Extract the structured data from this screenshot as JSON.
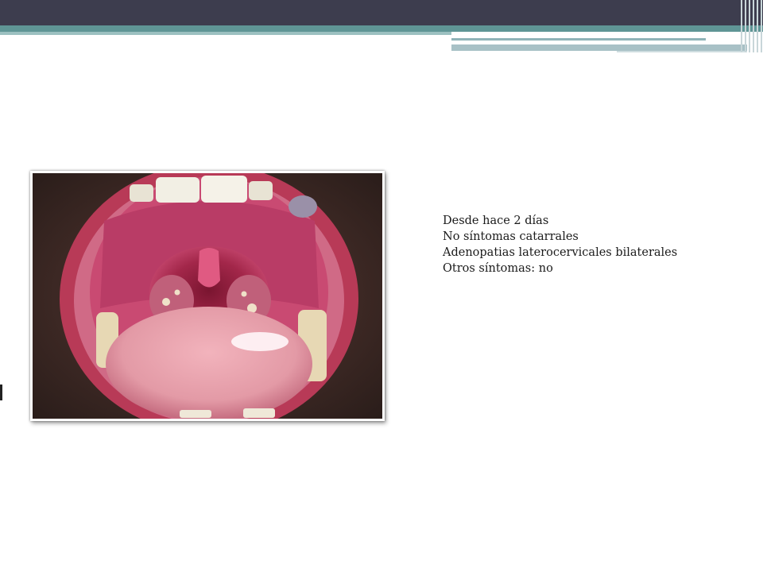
{
  "slide": {
    "notes": [
      " Desde hace 2 días",
      "No síntomas catarrales",
      "Adenopatias laterocervicales bilaterales",
      "Otros síntomas: no"
    ],
    "photo": {
      "icon": "open-mouth-throat-photo",
      "colors": {
        "skin": "#3a2a26",
        "lips": "#c23c5a",
        "palate": "#c94a72",
        "throat": "#8b1e3c",
        "tongue": "#e39aa6",
        "teeth": "#f2efe4"
      }
    },
    "theme": {
      "banner_dark": "#3d3d4e",
      "banner_teal": "#5f9595",
      "text_color": "#1a1a1a"
    }
  }
}
